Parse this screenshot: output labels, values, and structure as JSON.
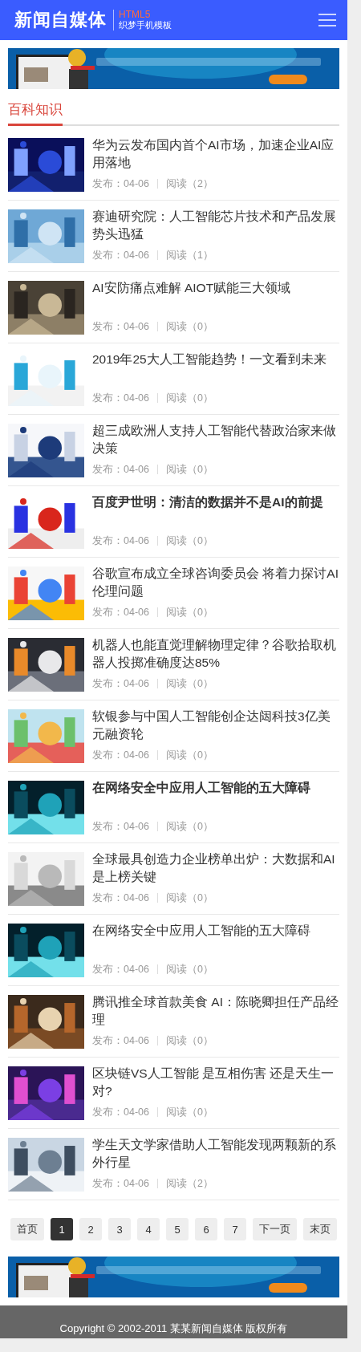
{
  "header": {
    "logo": "新闻自媒体",
    "badge": "HTML5",
    "subtitle": "织梦手机模板"
  },
  "section": {
    "title": "百科知识"
  },
  "items": [
    {
      "title": "华为云发布国内首个AI市场，加速企业AI应用落地",
      "bold": false,
      "published": "发布：04-06",
      "reads": "阅读（2）"
    },
    {
      "title": "赛迪研究院：人工智能芯片技术和产品发展势头迅猛",
      "bold": false,
      "published": "发布：04-06",
      "reads": "阅读（1）"
    },
    {
      "title": "AI安防痛点难解 AIOT赋能三大领域",
      "bold": false,
      "published": "发布：04-06",
      "reads": "阅读（0）"
    },
    {
      "title": "2019年25大人工智能趋势！一文看到未来",
      "bold": false,
      "published": "发布：04-06",
      "reads": "阅读（0）"
    },
    {
      "title": "超三成欧洲人支持人工智能代替政治家来做决策",
      "bold": false,
      "published": "发布：04-06",
      "reads": "阅读（0）"
    },
    {
      "title": "百度尹世明：清洁的数据并不是AI的前提",
      "bold": true,
      "published": "发布：04-06",
      "reads": "阅读（0）"
    },
    {
      "title": "谷歌宣布成立全球咨询委员会 将着力探讨AI伦理问题",
      "bold": false,
      "published": "发布：04-06",
      "reads": "阅读（0）"
    },
    {
      "title": "机器人也能直觉理解物理定律？谷歌拾取机器人投掷准确度达85%",
      "bold": false,
      "published": "发布：04-06",
      "reads": "阅读（0）"
    },
    {
      "title": "软银参与中国人工智能创企达闼科技3亿美元融资轮",
      "bold": false,
      "published": "发布：04-06",
      "reads": "阅读（0）"
    },
    {
      "title": "在网络安全中应用人工智能的五大障碍",
      "bold": true,
      "published": "发布：04-06",
      "reads": "阅读（0）"
    },
    {
      "title": "全球最具创造力企业榜单出炉：大数据和AI是上榜关键",
      "bold": false,
      "published": "发布：04-06",
      "reads": "阅读（0）"
    },
    {
      "title": "在网络安全中应用人工智能的五大障碍",
      "bold": false,
      "published": "发布：04-06",
      "reads": "阅读（0）"
    },
    {
      "title": "腾讯推全球首款美食 AI：陈晓卿担任产品经理",
      "bold": false,
      "published": "发布：04-06",
      "reads": "阅读（0）"
    },
    {
      "title": "区块链VS人工智能 是互相伤害 还是天生一对?",
      "bold": false,
      "published": "发布：04-06",
      "reads": "阅读（0）"
    },
    {
      "title": "学生天文学家借助人工智能发现两颗新的系外行星",
      "bold": false,
      "published": "发布：04-06",
      "reads": "阅读（2）"
    }
  ],
  "pagination": [
    {
      "label": "首页",
      "selected": false
    },
    {
      "label": "1",
      "selected": true
    },
    {
      "label": "2",
      "selected": false
    },
    {
      "label": "3",
      "selected": false
    },
    {
      "label": "4",
      "selected": false
    },
    {
      "label": "5",
      "selected": false
    },
    {
      "label": "6",
      "selected": false
    },
    {
      "label": "7",
      "selected": false
    },
    {
      "label": "下一页",
      "selected": false
    },
    {
      "label": "末页",
      "selected": false
    }
  ],
  "footer": {
    "copyright": "Copyright © 2002-2011 某某新闻自媒体 版权所有"
  }
}
